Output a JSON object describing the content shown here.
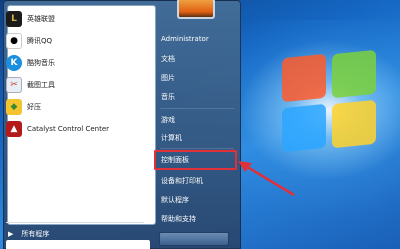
{
  "start_menu": {
    "pinned": [
      {
        "label": "英雄联盟",
        "icon": "league-of-legends-icon",
        "color": "#1b1b1b"
      },
      {
        "label": "腾讯QQ",
        "icon": "qq-penguin-icon",
        "color": "#000000"
      },
      {
        "label": "酷狗音乐",
        "icon": "kugou-music-icon",
        "color": "#1a8fe0"
      },
      {
        "label": "截图工具",
        "icon": "snipping-tool-icon",
        "color": "#c0392b"
      },
      {
        "label": "好压",
        "icon": "haozip-icon",
        "color": "#3c8a2e"
      },
      {
        "label": "Catalyst Control Center",
        "icon": "catalyst-icon",
        "color": "#b31b1b"
      }
    ],
    "all_programs": "所有程序"
  },
  "right_pane": {
    "items": [
      {
        "label": "Administrator"
      },
      {
        "label": "文档"
      },
      {
        "label": "图片"
      },
      {
        "label": "音乐"
      },
      {
        "label": "游戏"
      },
      {
        "label": "计算机"
      },
      {
        "label": "控制面板"
      },
      {
        "label": "设备和打印机"
      },
      {
        "label": "默认程序"
      },
      {
        "label": "帮助和支持"
      }
    ],
    "highlighted_item": "控制面板",
    "highlight_color": "#e0303a"
  }
}
